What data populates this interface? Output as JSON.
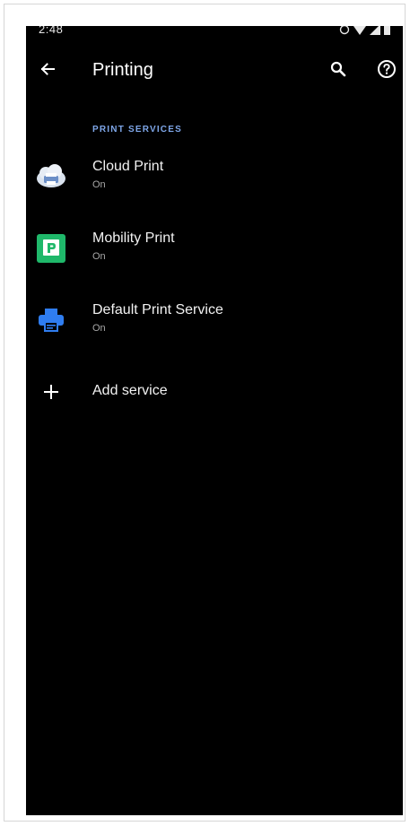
{
  "status_bar": {
    "time": "2:48"
  },
  "app_bar": {
    "back_icon": "arrow-back-icon",
    "title": "Printing",
    "search_icon": "search-icon",
    "help_icon": "help-circle-icon"
  },
  "section": {
    "header": "PRINT SERVICES"
  },
  "services": [
    {
      "label": "Cloud Print",
      "status": "On",
      "icon": "cloud-print-icon"
    },
    {
      "label": "Mobility Print",
      "status": "On",
      "icon": "mobility-print-icon",
      "icon_color": "#1fb86a"
    },
    {
      "label": "Default Print Service",
      "status": "On",
      "icon": "printer-icon",
      "icon_color": "#2f7df0"
    }
  ],
  "add_service": {
    "label": "Add service",
    "icon": "plus-icon"
  },
  "colors": {
    "background": "#000000",
    "accent": "#7ea6e8"
  }
}
